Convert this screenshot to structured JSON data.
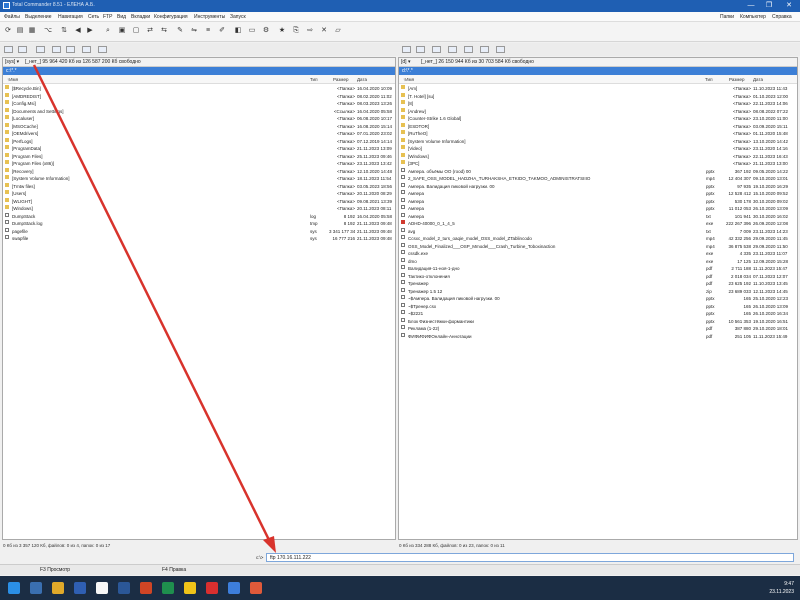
{
  "window": {
    "title": "Total Commander 8.51 - ЕЛЕНА А.Б.",
    "controls": [
      "—",
      "❐",
      "✕"
    ]
  },
  "menu": {
    "left": [
      "Файлы",
      "Выделение",
      "Навигация",
      "Сеть",
      "FTP",
      "Вид",
      "Вкладки",
      "Конфигурация",
      "Инструменты",
      "Запуск"
    ],
    "right": [
      "Папки",
      "Компьютер",
      "Справка"
    ]
  },
  "left_panel": {
    "drive_select": "[sys] ▾",
    "path_info": "[_нет_]  95 964 420 Кб из 126 587 200 Кб свободно",
    "current_dir": "c:\\*.*",
    "headers": {
      "name": "↑Имя",
      "ext": "Тип",
      "size": "Размер",
      "date": "Дата"
    },
    "rows": [
      {
        "name": "[$Recycle.Bin]",
        "ext": "",
        "size": "<Папка>",
        "date": "16.04.2020 10:09",
        "type": "dir"
      },
      {
        "name": "[AMDREDIST]",
        "ext": "",
        "size": "<Папка>",
        "date": "08.02.2020 11:02",
        "type": "dir"
      },
      {
        "name": "[Config.Msi]",
        "ext": "",
        "size": "<Папка>",
        "date": "08.03.2023 13:26",
        "type": "dir"
      },
      {
        "name": "[Documents and Settings]",
        "ext": "",
        "size": "<Ссылка>",
        "date": "16.04.2020 05:58",
        "type": "dir"
      },
      {
        "name": "[Localuser]",
        "ext": "",
        "size": "<Папка>",
        "date": "06.08.2020 10:17",
        "type": "dir"
      },
      {
        "name": "[MSOCache]",
        "ext": "",
        "size": "<Папка>",
        "date": "16.08.2020 15:14",
        "type": "dir"
      },
      {
        "name": "[OEMdrivers]",
        "ext": "",
        "size": "<Папка>",
        "date": "07.01.2020 23:02",
        "type": "dir"
      },
      {
        "name": "[PerfLogs]",
        "ext": "",
        "size": "<Папка>",
        "date": "07.12.2019 14:14",
        "type": "dir"
      },
      {
        "name": "[ProgramData]",
        "ext": "",
        "size": "<Папка>",
        "date": "21.11.2023 13:09",
        "type": "dir"
      },
      {
        "name": "[Program Files]",
        "ext": "",
        "size": "<Папка>",
        "date": "25.11.2023 09:46",
        "type": "dir"
      },
      {
        "name": "[Program Files (x86)]",
        "ext": "",
        "size": "<Папка>",
        "date": "23.11.2023 13:42",
        "type": "dir"
      },
      {
        "name": "[Recovery]",
        "ext": "",
        "size": "<Папка>",
        "date": "12.10.2020 14:48",
        "type": "dir"
      },
      {
        "name": "[System Volume Information]",
        "ext": "",
        "size": "<Папка>",
        "date": "18.11.2023 11:54",
        "type": "dir"
      },
      {
        "name": "[Tmtw files]",
        "ext": "",
        "size": "<Папка>",
        "date": "03.05.2023 18:56",
        "type": "dir"
      },
      {
        "name": "[Users]",
        "ext": "",
        "size": "<Папка>",
        "date": "20.11.2020 08:29",
        "type": "dir"
      },
      {
        "name": "[WLIGHT]",
        "ext": "",
        "size": "<Папка>",
        "date": "09.08.2021 13:39",
        "type": "dir"
      },
      {
        "name": "[Windows]",
        "ext": "",
        "size": "<Папка>",
        "date": "20.11.2023 08:11",
        "type": "dir"
      },
      {
        "name": "DumpStack",
        "ext": "log",
        "size": "8 192",
        "date": "16.04.2020 05:58",
        "type": "file"
      },
      {
        "name": "DumpStack.log",
        "ext": "tmp",
        "size": "8 192",
        "date": "21.11.2023 09:48",
        "type": "file"
      },
      {
        "name": "pagefile",
        "ext": "sys",
        "size": "3 341 177 344",
        "date": "21.11.2023 09:48",
        "type": "file"
      },
      {
        "name": "swapfile",
        "ext": "sys",
        "size": "16 777 216",
        "date": "21.11.2023 09:48",
        "type": "file"
      }
    ],
    "status": "0 Кб из 3 357 120 Кб, файлов: 0 из 4, папок: 0 из 17"
  },
  "right_panel": {
    "drive_select": "[d] ▾",
    "path_info": "[_нет_]  26 150 944 Кб из 30 703 584 Кб свободно",
    "current_dir": "d:\\*.*",
    "headers": {
      "name": "↑Имя",
      "ext": "Тип",
      "size": "Размер",
      "date": "Дата"
    },
    "rows": [
      {
        "name": "[Am]",
        "ext": "",
        "size": "<Папка>",
        "date": "11.10.2023 11:43",
        "type": "dir"
      },
      {
        "name": "[T. Hotel] [su]",
        "ext": "",
        "size": "<Папка>",
        "date": "01.10.2023 12:00",
        "type": "dir"
      },
      {
        "name": "[8]",
        "ext": "",
        "size": "<Папка>",
        "date": "22.11.2023 14:06",
        "type": "dir"
      },
      {
        "name": "[Andrew]",
        "ext": "",
        "size": "<Папка>",
        "date": "08.08.2022 07:22",
        "type": "dir"
      },
      {
        "name": "[Counter-Strike 1.6 Global]",
        "ext": "",
        "size": "<Папка>",
        "date": "23.10.2020 11:00",
        "type": "dir"
      },
      {
        "name": "[ESDTOR]",
        "ext": "",
        "size": "<Папка>",
        "date": "03.09.2020 15:11",
        "type": "dir"
      },
      {
        "name": "[RuTheO]",
        "ext": "",
        "size": "<Папка>",
        "date": "01.11.2020 15:48",
        "type": "dir"
      },
      {
        "name": "[System Volume Information]",
        "ext": "",
        "size": "<Папка>",
        "date": "13.10.2020 14:42",
        "type": "dir"
      },
      {
        "name": "[Video]",
        "ext": "",
        "size": "<Папка>",
        "date": "23.11.2020 14:16",
        "type": "dir"
      },
      {
        "name": "[Windows]",
        "ext": "",
        "size": "<Папка>",
        "date": "22.11.2023 16:43",
        "type": "dir"
      },
      {
        "name": "[ЗРС]",
        "ext": "",
        "size": "<Папка>",
        "date": "21.11.2023 13:00",
        "type": "dir"
      },
      {
        "name": "Ампера. объёмы ОО (rood) 00",
        "ext": "pptx",
        "size": "367 192",
        "date": "09.05.2020 14:22",
        "type": "file"
      },
      {
        "name": "2_SAFE_OSS_MODEL_HADZHA_TURHAKSHA_ETKIDO_TAKMOO_ADMINISTRATSIIIO",
        "ext": "mp4",
        "size": "12 404 307",
        "date": "09.10.2020 13:01",
        "type": "file"
      },
      {
        "name": "Ампера. Валидация пиковой нагрузки. 00",
        "ext": "pptx",
        "size": "97 935",
        "date": "19.10.2020 16:29",
        "type": "file"
      },
      {
        "name": "Ампера",
        "ext": "pptx",
        "size": "12 528 412",
        "date": "15.10.2020 09:52",
        "type": "file"
      },
      {
        "name": "Ампера",
        "ext": "pptx",
        "size": "530 178",
        "date": "30.10.2020 09:02",
        "type": "file"
      },
      {
        "name": "Ампера",
        "ext": "pptx",
        "size": "11 012 053",
        "date": "26.10.2020 13:09",
        "type": "file"
      },
      {
        "name": "Ампера",
        "ext": "txt",
        "size": "101 941",
        "date": "30.10.2020 16:02",
        "type": "file"
      },
      {
        "name": "ADHD-40000_0_1_4_5",
        "ext": "exe",
        "size": "222 267 396",
        "date": "26.09.2020 12:08",
        "type": "pdf"
      },
      {
        "name": "avg",
        "ext": "txt",
        "size": "7 009",
        "date": "23.11.2023 14:23",
        "type": "file"
      },
      {
        "name": "Ccsxc_model_2_turs_oaqie_model_OSS_model_ZTablincodo",
        "ext": "mp4",
        "size": "42 332 256",
        "date": "29.09.2020 11:45",
        "type": "file"
      },
      {
        "name": "OSS_Model_Finalized___OSP_Mmodel___Crash_Turbine_Toboxinaction",
        "ext": "mp4",
        "size": "36 875 538",
        "date": "29.09.2020 11:50",
        "type": "file"
      },
      {
        "name": "cssdk.exe",
        "ext": "exe",
        "size": "4 335",
        "date": "23.11.2023 11:07",
        "type": "file"
      },
      {
        "name": "dmo",
        "ext": "exe",
        "size": "17 125",
        "date": "12.09.2020 15:28",
        "type": "file"
      },
      {
        "name": "Валидация-11-ноя-1-дно",
        "ext": "pdf",
        "size": "2 711 188",
        "date": "11.11.2023 15:47",
        "type": "file"
      },
      {
        "name": "Тактико-отклонения",
        "ext": "pdf",
        "size": "2 018 034",
        "date": "07.11.2023 12:07",
        "type": "file"
      },
      {
        "name": "Тренажер",
        "ext": "pdf",
        "size": "23 625 192",
        "date": "11.10.2023 13:45",
        "type": "file"
      },
      {
        "name": "Тренажер 1.5 12",
        "ext": "zip",
        "size": "23 689 033",
        "date": "12.11.2023 14:45",
        "type": "file"
      },
      {
        "name": "~$Ампера. Валидация пиковой нагрузки. 00",
        "ext": "pptx",
        "size": "165",
        "date": "25.10.2020 12:23",
        "type": "file"
      },
      {
        "name": "~$Тренер.csx",
        "ext": "pptx",
        "size": "165",
        "date": "26.10.2020 13:09",
        "type": "file"
      },
      {
        "name": "~$2221",
        "ext": "pptx",
        "size": "165",
        "date": "26.10.2020 16:34",
        "type": "file"
      },
      {
        "name": "Блок Физнестёжки-формантики",
        "ext": "pptx",
        "size": "10 561 353",
        "date": "19.10.2020 16:51",
        "type": "file"
      },
      {
        "name": "Реклама (1-22)",
        "ext": "pdf",
        "size": "387 880",
        "date": "29.10.2020 18:01",
        "type": "file"
      },
      {
        "name": "ФИФИФИФОнлайн-Аннотации",
        "ext": "pdf",
        "size": "251 105",
        "date": "11.11.2023 15:49",
        "type": "file"
      }
    ],
    "status": "0 Кб из 334 288 Кб, файлов: 0 из 23, папок: 0 из 11"
  },
  "command_line": {
    "prompt": "c:\\>",
    "value": "ftp 170.16.111.222"
  },
  "function_keys": [
    "F3 Просмотр",
    "F4 Правка"
  ],
  "taskbar": {
    "time": "9:47",
    "date": "23.11.2023"
  }
}
